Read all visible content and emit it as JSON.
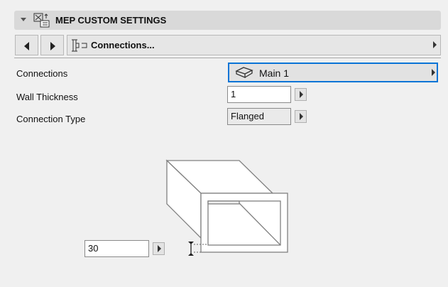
{
  "header": {
    "title": "MEP CUSTOM SETTINGS"
  },
  "nav": {
    "section": "Connections..."
  },
  "rows": [
    {
      "label": "Connections",
      "value": "Main 1"
    },
    {
      "label": "Wall Thickness",
      "value": "1"
    },
    {
      "label": "Connection Type",
      "value": "Flanged"
    }
  ],
  "diagram": {
    "thickness_value": "30"
  },
  "colors": {
    "accent": "#0a74d6"
  }
}
